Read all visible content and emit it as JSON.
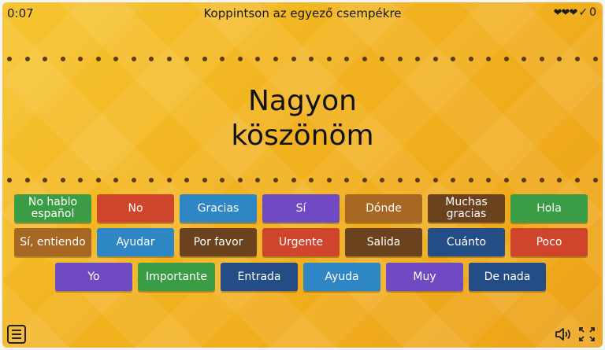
{
  "header": {
    "timer": "0:07",
    "title": "Koppintson az egyező csempékre",
    "hearts": "❤❤❤",
    "check": "✓",
    "score": "0"
  },
  "prompt": {
    "line1": "Nagyon",
    "line2": "köszönöm"
  },
  "tiles": [
    {
      "label": "No hablo español",
      "color": "#3a9d45"
    },
    {
      "label": "No",
      "color": "#cf452c"
    },
    {
      "label": "Gracias",
      "color": "#2f86c5"
    },
    {
      "label": "Sí",
      "color": "#6f4ac3"
    },
    {
      "label": "Dónde",
      "color": "#a66722"
    },
    {
      "label": "Muchas gracias",
      "color": "#6a421d"
    },
    {
      "label": "Hola",
      "color": "#3a9d45"
    },
    {
      "label": "Sí, entiendo",
      "color": "#a66722"
    },
    {
      "label": "Ayudar",
      "color": "#2f86c5"
    },
    {
      "label": "Por favor",
      "color": "#6a421d"
    },
    {
      "label": "Urgente",
      "color": "#cf452c"
    },
    {
      "label": "Salida",
      "color": "#6a421d"
    },
    {
      "label": "Cuánto",
      "color": "#244d86"
    },
    {
      "label": "Poco",
      "color": "#cf452c"
    },
    {
      "label": "Yo",
      "color": "#6f4ac3"
    },
    {
      "label": "Importante",
      "color": "#3a9d45"
    },
    {
      "label": "Entrada",
      "color": "#244d86"
    },
    {
      "label": "Ayuda",
      "color": "#2f86c5"
    },
    {
      "label": "Muy",
      "color": "#6f4ac3"
    },
    {
      "label": "De nada",
      "color": "#244d86"
    }
  ],
  "footer": {
    "menu_icon": "menu-icon",
    "volume_icon": "volume-icon",
    "fullscreen_icon": "fullscreen-icon"
  }
}
